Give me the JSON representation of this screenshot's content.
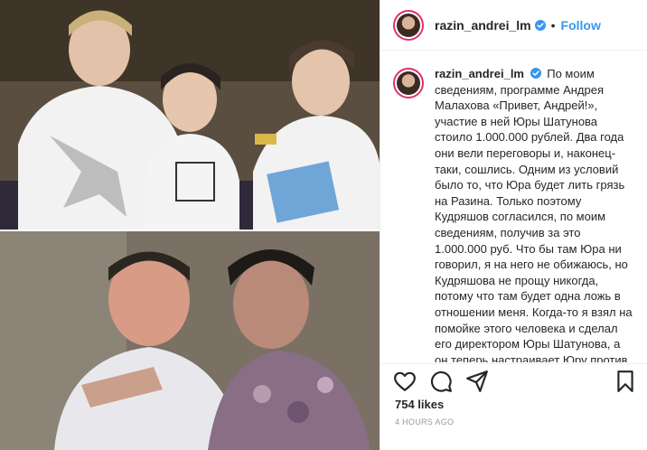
{
  "post": {
    "username": "razin_andrei_lm",
    "separator": "•",
    "follow_label": "Follow",
    "verified_icon": "verified-badge-icon",
    "caption_username": "razin_andrei_lm",
    "caption": "По моим сведениям, программе Андрея Малахова «Привет, Андрей!», участие в ней Юры Шатунова стоило 1.000.000 рублей. Два года они вели переговоры и, наконец-таки, сошлись. Одним из условий было то, что Юра будет лить грязь на Разина. Только поэтому Кудряшов согласился, по моим сведениям, получив за это 1.000.000 руб. Что бы там Юра ни говорил, я на него не обижаюсь, но Кудряшова не прощу никогда, потому что там будет одна ложь в отношении меня. Когда-то я взял на помойке этого человека и сделал его директором Юры Шатунова, а он теперь настраивает Юру против меня и",
    "likes": "754 likes",
    "time": "4 HOURS AGO"
  },
  "icons": {
    "like": "heart-icon",
    "comment": "comment-icon",
    "share": "share-icon",
    "save": "bookmark-icon"
  },
  "colors": {
    "accent": "#3897f0",
    "text": "#262626",
    "muted": "#999999",
    "border": "#efefef"
  }
}
